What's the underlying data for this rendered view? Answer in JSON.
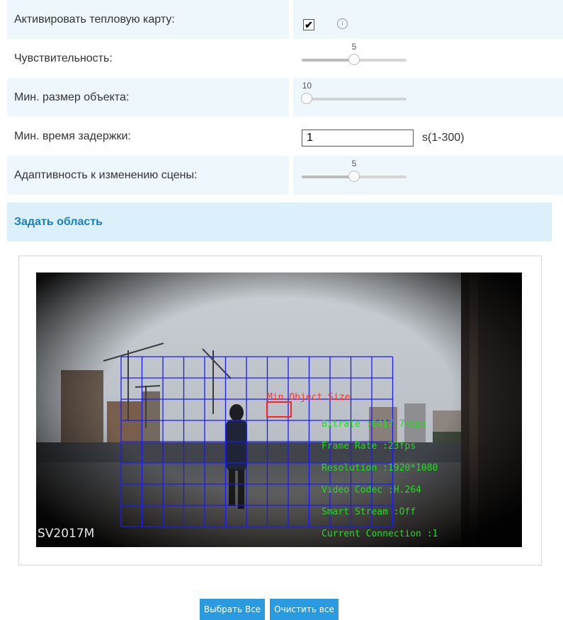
{
  "settings": {
    "heatmap": {
      "label": "Активировать тепловую карту:",
      "checked": "✔"
    },
    "sensitivity": {
      "label": "Чувствительность:",
      "value": "5",
      "level": 0.5
    },
    "min_object_size": {
      "label": "Мин. размер объекта:",
      "value": "10",
      "level": 0.05
    },
    "min_delay": {
      "label": "Мин. время задержки:",
      "value": "1",
      "unit": "s(1-300)"
    },
    "scene_adaptivity": {
      "label": "Адаптивность к изменению сцены:",
      "value": "5",
      "level": 0.5
    }
  },
  "section": {
    "title": "Задать область"
  },
  "video": {
    "watermark": "SV2017M",
    "min_object_label": "Min.Object Size",
    "osd": [
      "Bitrate :6417.7kbps",
      "Frame Rate :23fps",
      "Resolution :1920*1080",
      "Video Codec :H.264",
      "Smart Stream :Off",
      "Current Connection :1"
    ]
  },
  "buttons": {
    "select_all": "Выбрать Все",
    "clear_all": "Очистить все"
  },
  "colors": {
    "accent": "#2a9be0",
    "header_text": "#1a7fc1",
    "grid": "#1a1aff",
    "osd_text": "#22dd22",
    "object_box": "#ff2222"
  }
}
